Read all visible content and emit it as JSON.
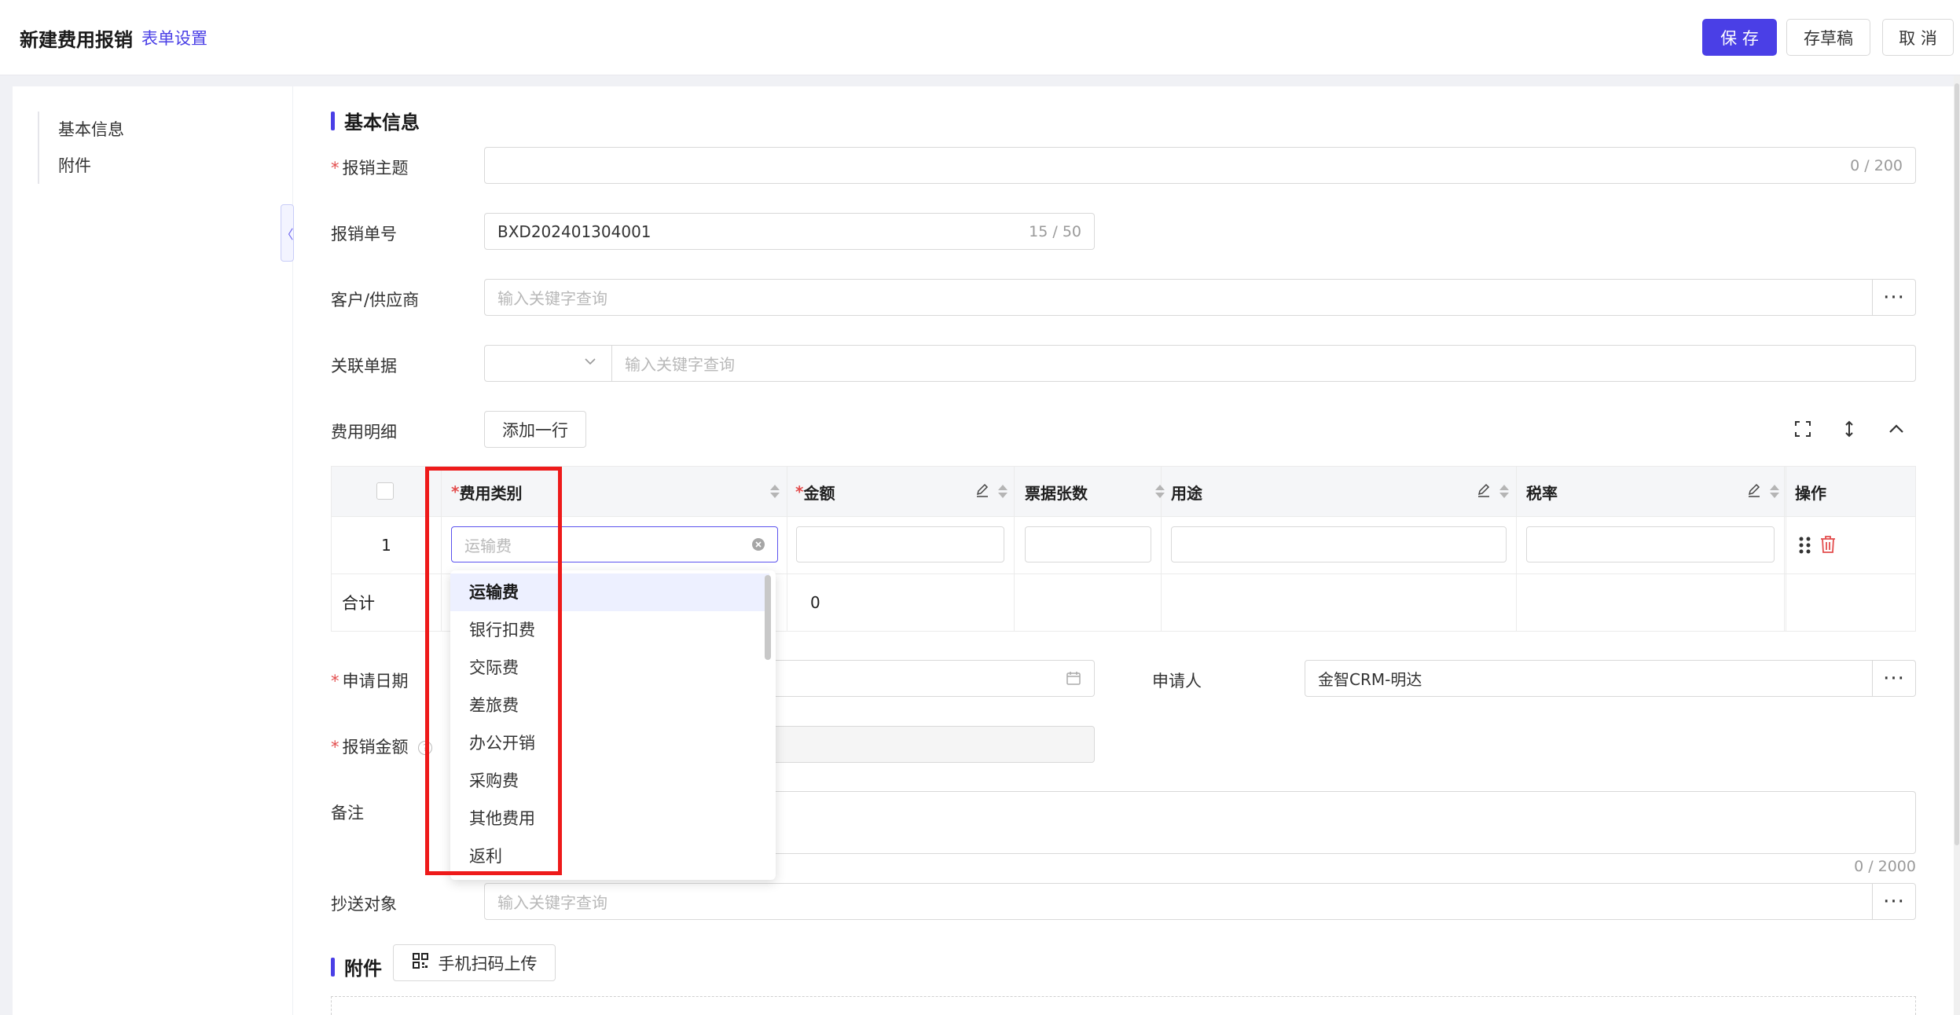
{
  "header": {
    "title": "新建费用报销",
    "form_settings": "表单设置",
    "save": "保 存",
    "draft": "存草稿",
    "cancel": "取 消"
  },
  "nav": {
    "items": [
      "基本信息",
      "附件"
    ]
  },
  "section_basic": "基本信息",
  "fields": {
    "subject": {
      "label": "报销主题",
      "counter": "0 / 200"
    },
    "number": {
      "label": "报销单号",
      "value": "BXD202401304001",
      "counter": "15 / 50"
    },
    "customer": {
      "label": "客户/供应商",
      "placeholder": "输入关键字查询"
    },
    "related": {
      "label": "关联单据",
      "placeholder": "输入关键字查询"
    },
    "details": {
      "label": "费用明细",
      "add_row": "添加一行"
    },
    "apply_date": {
      "label": "申请日期"
    },
    "applicant": {
      "label": "申请人",
      "value": "金智CRM-明达"
    },
    "amount": {
      "label": "报销金额"
    },
    "remark": {
      "label": "备注",
      "counter": "0 / 2000"
    },
    "cc": {
      "label": "抄送对象",
      "placeholder": "输入关键字查询"
    }
  },
  "table": {
    "columns": [
      "费用类别",
      "金额",
      "票据张数",
      "用途",
      "税率",
      "操作"
    ],
    "row_index": "1",
    "category_placeholder": "运输费",
    "total_label": "合计",
    "total_amount": "0"
  },
  "dropdown": {
    "options": [
      "运输费",
      "银行扣费",
      "交际费",
      "差旅费",
      "办公开销",
      "采购费",
      "其他费用",
      "返利"
    ],
    "selected": "运输费"
  },
  "section_attachment": "附件",
  "scan_upload": "手机扫码上传",
  "colors": {
    "accent": "#4a3fe6",
    "required": "#e34d4d",
    "highlight": "#ee1a1a"
  }
}
